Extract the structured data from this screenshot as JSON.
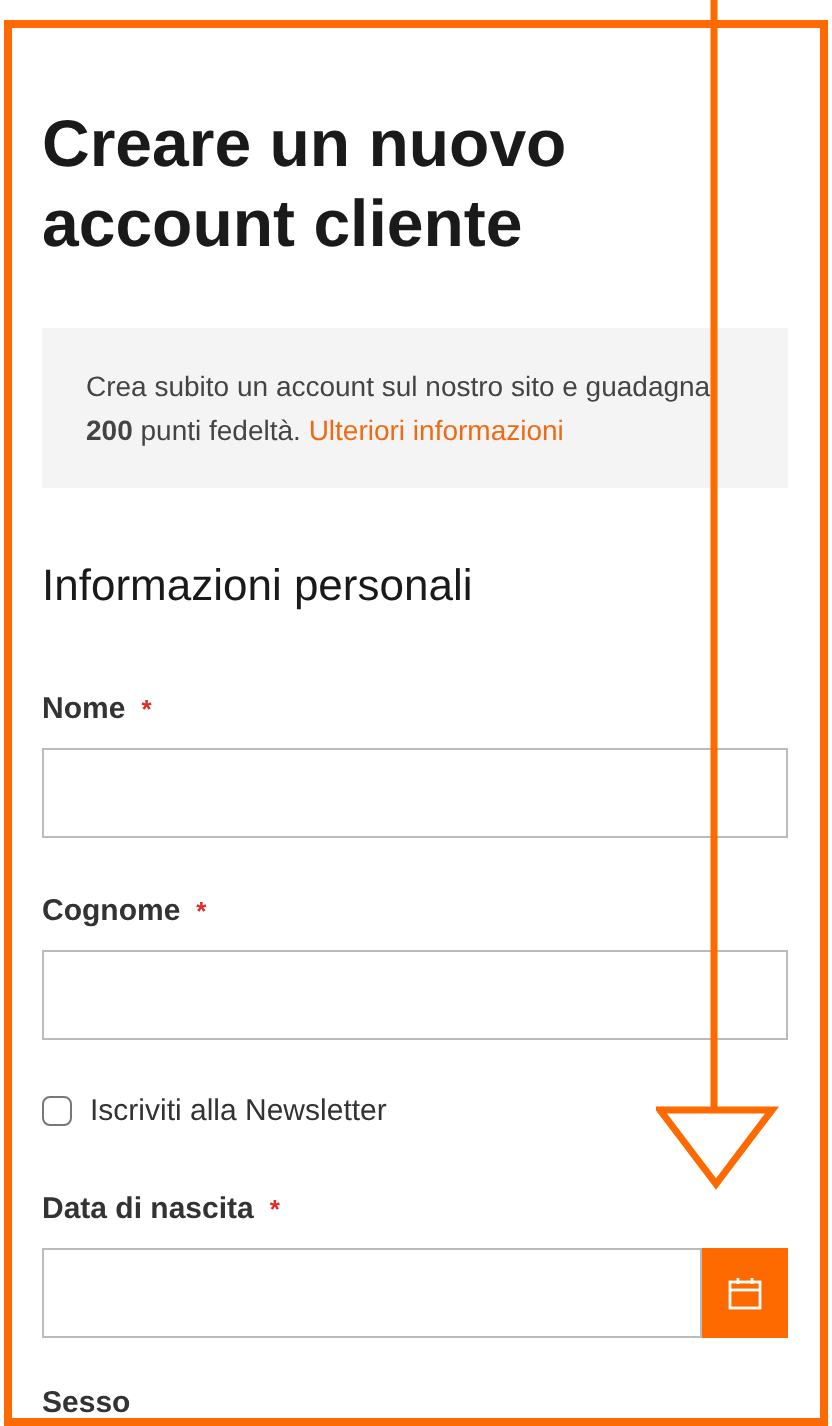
{
  "title": "Creare un nuovo account cliente",
  "notice": {
    "text": "Crea subito un account sul nostro sito e guadagna **200** punti fedeltà.",
    "link": "Ulteriori informazioni"
  },
  "section": "Informazioni personali",
  "required_mark": "*",
  "fields": [
    {
      "kind": "text",
      "label": "Nome",
      "required": true
    },
    {
      "kind": "text",
      "label": "Cognome",
      "required": true
    },
    {
      "kind": "checkbox",
      "label": "Iscriviti alla Newsletter",
      "checked": false
    },
    {
      "kind": "date",
      "label": "Data di nascita",
      "required": true
    },
    {
      "kind": "heading",
      "label": "Sesso"
    }
  ]
}
